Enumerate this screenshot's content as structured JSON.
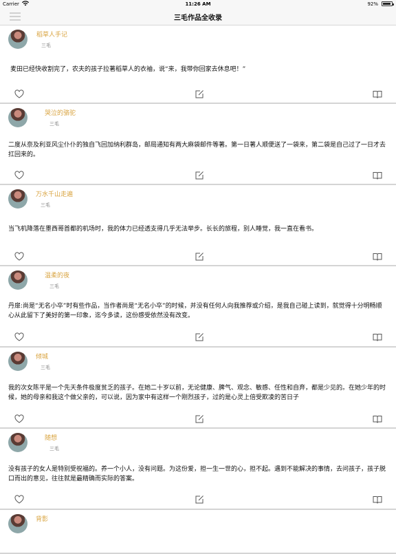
{
  "status_bar": {
    "carrier": "Carrier",
    "time": "11:26 AM",
    "battery": "92%",
    "battery_level": 0.92
  },
  "nav": {
    "title": "三毛作品全收录"
  },
  "cards": [
    {
      "author": "稻草人手记",
      "source": "三毛",
      "excerpt": "麦田已经快收割完了，农夫的孩子拉著稻草人的衣袖，说“来，我带你回家去休息吧！”"
    },
    {
      "author": "哭泣的骆驼",
      "source": "三毛",
      "excerpt": "二度从奈及利亚风尘仆仆的独自飞回加纳利群岛，邮局通知有两大麻袋邮件等著。第一日著人顺便送了一袋来，第二袋是自己过了一日才去扛回来的。"
    },
    {
      "author": "万水千山走遍",
      "source": "三毛",
      "excerpt": "当飞机降落在墨西哥首都的机场时，我的体力已经透支得几乎无法举步。长长的旅程，别人睡觉，我一直在看书。"
    },
    {
      "author": "温柔的夜",
      "source": "三毛",
      "excerpt": "丹扉:尚是“无名小卒”时有些作品，当作者尚是“无名小卒”的时候，并没有任何人向我推荐或介绍，是我自己碰上读到，就觉得十分明畅顺心从此留下了美好的第一印象，迄今多读，这份感受依然没有改变。"
    },
    {
      "author": "倾城",
      "source": "三毛",
      "excerpt": "我的次女陈平是一个先天条件极度贫乏的孩子。在她二十岁以前，无论健康、脾气、观念、敏感、任性和自弃，都是少见的。在她少年的时候，她的母亲和我这个做父亲的，可以说，因为家中有这样一个刚烈孩子，过的是心灵上倍受欺凌的苦日子"
    },
    {
      "author": "随想",
      "source": "三毛",
      "excerpt": "没有孩子的女人是特别受祝福的。养一个小人，没有问题。为这份爱，担一生一世的心，担不起。遇到不能解决的事情，去问孩子，孩子脱口而出的意见，往往就是最精确而实际的答案。"
    },
    {
      "author": "背影",
      "source": "",
      "excerpt": ""
    }
  ]
}
